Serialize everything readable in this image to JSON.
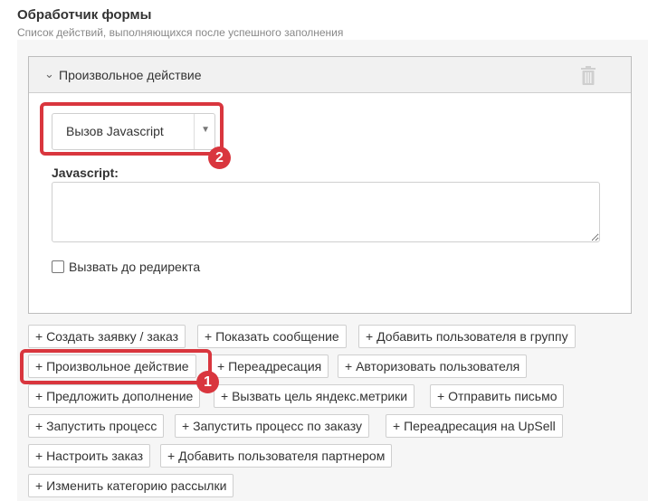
{
  "form_handler": {
    "title": "Обработчик формы",
    "subtitle": "Список действий, выполняющихся после успешного заполнения"
  },
  "action_panel": {
    "title": "Произвольное действие",
    "select_value": "Вызов Javascript",
    "js_label": "Javascript:",
    "js_value": "",
    "checkbox_label": "Вызвать до редиректа",
    "checkbox_checked": false
  },
  "add_buttons": [
    "+ Создать заявку / заказ",
    "+ Показать сообщение",
    "+ Добавить пользователя в группу",
    "+ Произвольное действие",
    "+ Переадресация",
    "+ Авторизовать пользователя",
    "+ Предложить дополнение",
    "+ Вызвать цель яндекс.метрики",
    "+ Отправить письмо",
    "+ Запустить процесс",
    "+ Запустить процесс по заказу",
    "+ Переадресация на UpSell",
    "+ Настроить заказ",
    "+ Добавить пользователя партнером",
    "+ Изменить категорию рассылки"
  ],
  "annotations": {
    "badge_1": "1",
    "badge_2": "2",
    "highlight_color": "#d9363e"
  },
  "icons": {
    "collapse": "chevron-down-icon",
    "delete": "trash-icon",
    "dropdown": "caret-down-icon"
  }
}
